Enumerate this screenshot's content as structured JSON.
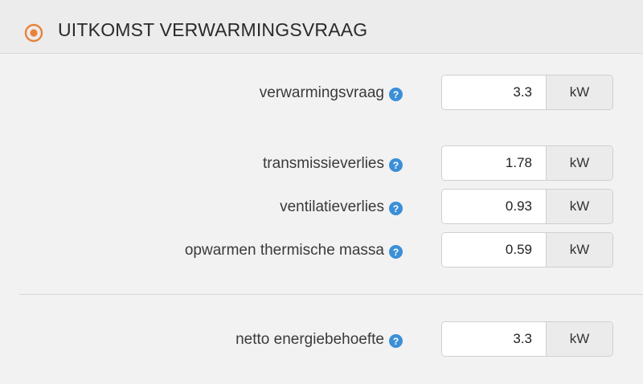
{
  "header": {
    "title": "UITKOMST VERWARMINGSVRAAG",
    "icon": "target-icon",
    "accent_color": "#e8833a"
  },
  "help_icon_color": "#3b8fd8",
  "rows": [
    {
      "label": "verwarmingsvraag",
      "value": "3.3",
      "unit": "kW"
    },
    {
      "label": "transmissieverlies",
      "value": "1.78",
      "unit": "kW"
    },
    {
      "label": "ventilatieverlies",
      "value": "0.93",
      "unit": "kW"
    },
    {
      "label": "opwarmen thermische massa",
      "value": "0.59",
      "unit": "kW"
    },
    {
      "label": "netto energiebehoefte",
      "value": "3.3",
      "unit": "kW"
    }
  ]
}
